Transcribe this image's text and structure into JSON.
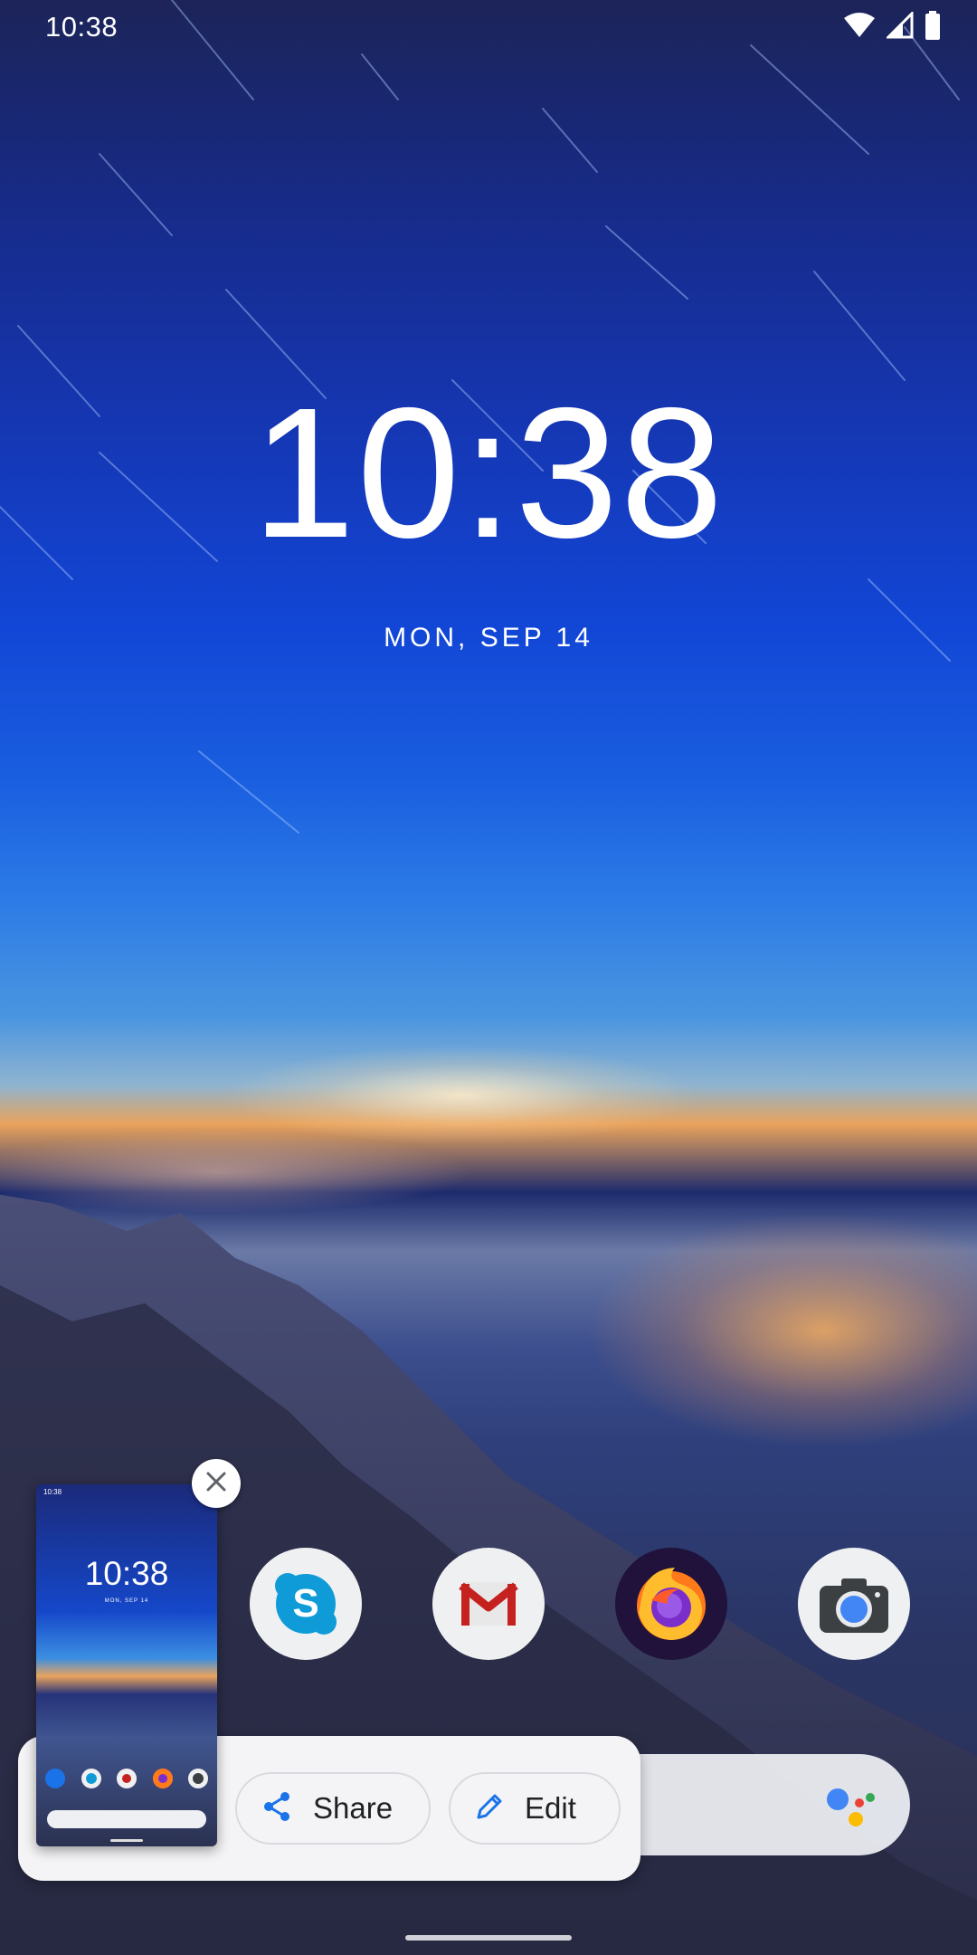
{
  "status_bar": {
    "time": "10:38",
    "icons": [
      "wifi-icon",
      "cell-signal-icon",
      "battery-icon"
    ]
  },
  "lock_clock": {
    "time": "10:38",
    "date": "MON, SEP 14"
  },
  "dock": {
    "apps": [
      {
        "name": "Skype",
        "icon": "skype-icon",
        "color": "#0f9bd7"
      },
      {
        "name": "Gmail",
        "icon": "gmail-icon",
        "color": "#c5221f"
      },
      {
        "name": "Firefox",
        "icon": "firefox-icon",
        "color": "#ff7a1a"
      },
      {
        "name": "Camera",
        "icon": "camera-icon",
        "color": "#4285f4"
      }
    ]
  },
  "search_bar": {
    "assistant_icon": "google-assistant-icon",
    "assistant_colors": [
      "#4285f4",
      "#ea4335",
      "#fbbc04",
      "#34a853"
    ]
  },
  "screenshot_preview": {
    "small_time": "10:38",
    "clock": "10:38",
    "date": "MON, SEP 14",
    "close_icon": "close-icon",
    "actions": {
      "share_label": "Share",
      "edit_label": "Edit"
    }
  },
  "colors": {
    "accent": "#1a73e8",
    "panel": "#f4f4f6"
  }
}
